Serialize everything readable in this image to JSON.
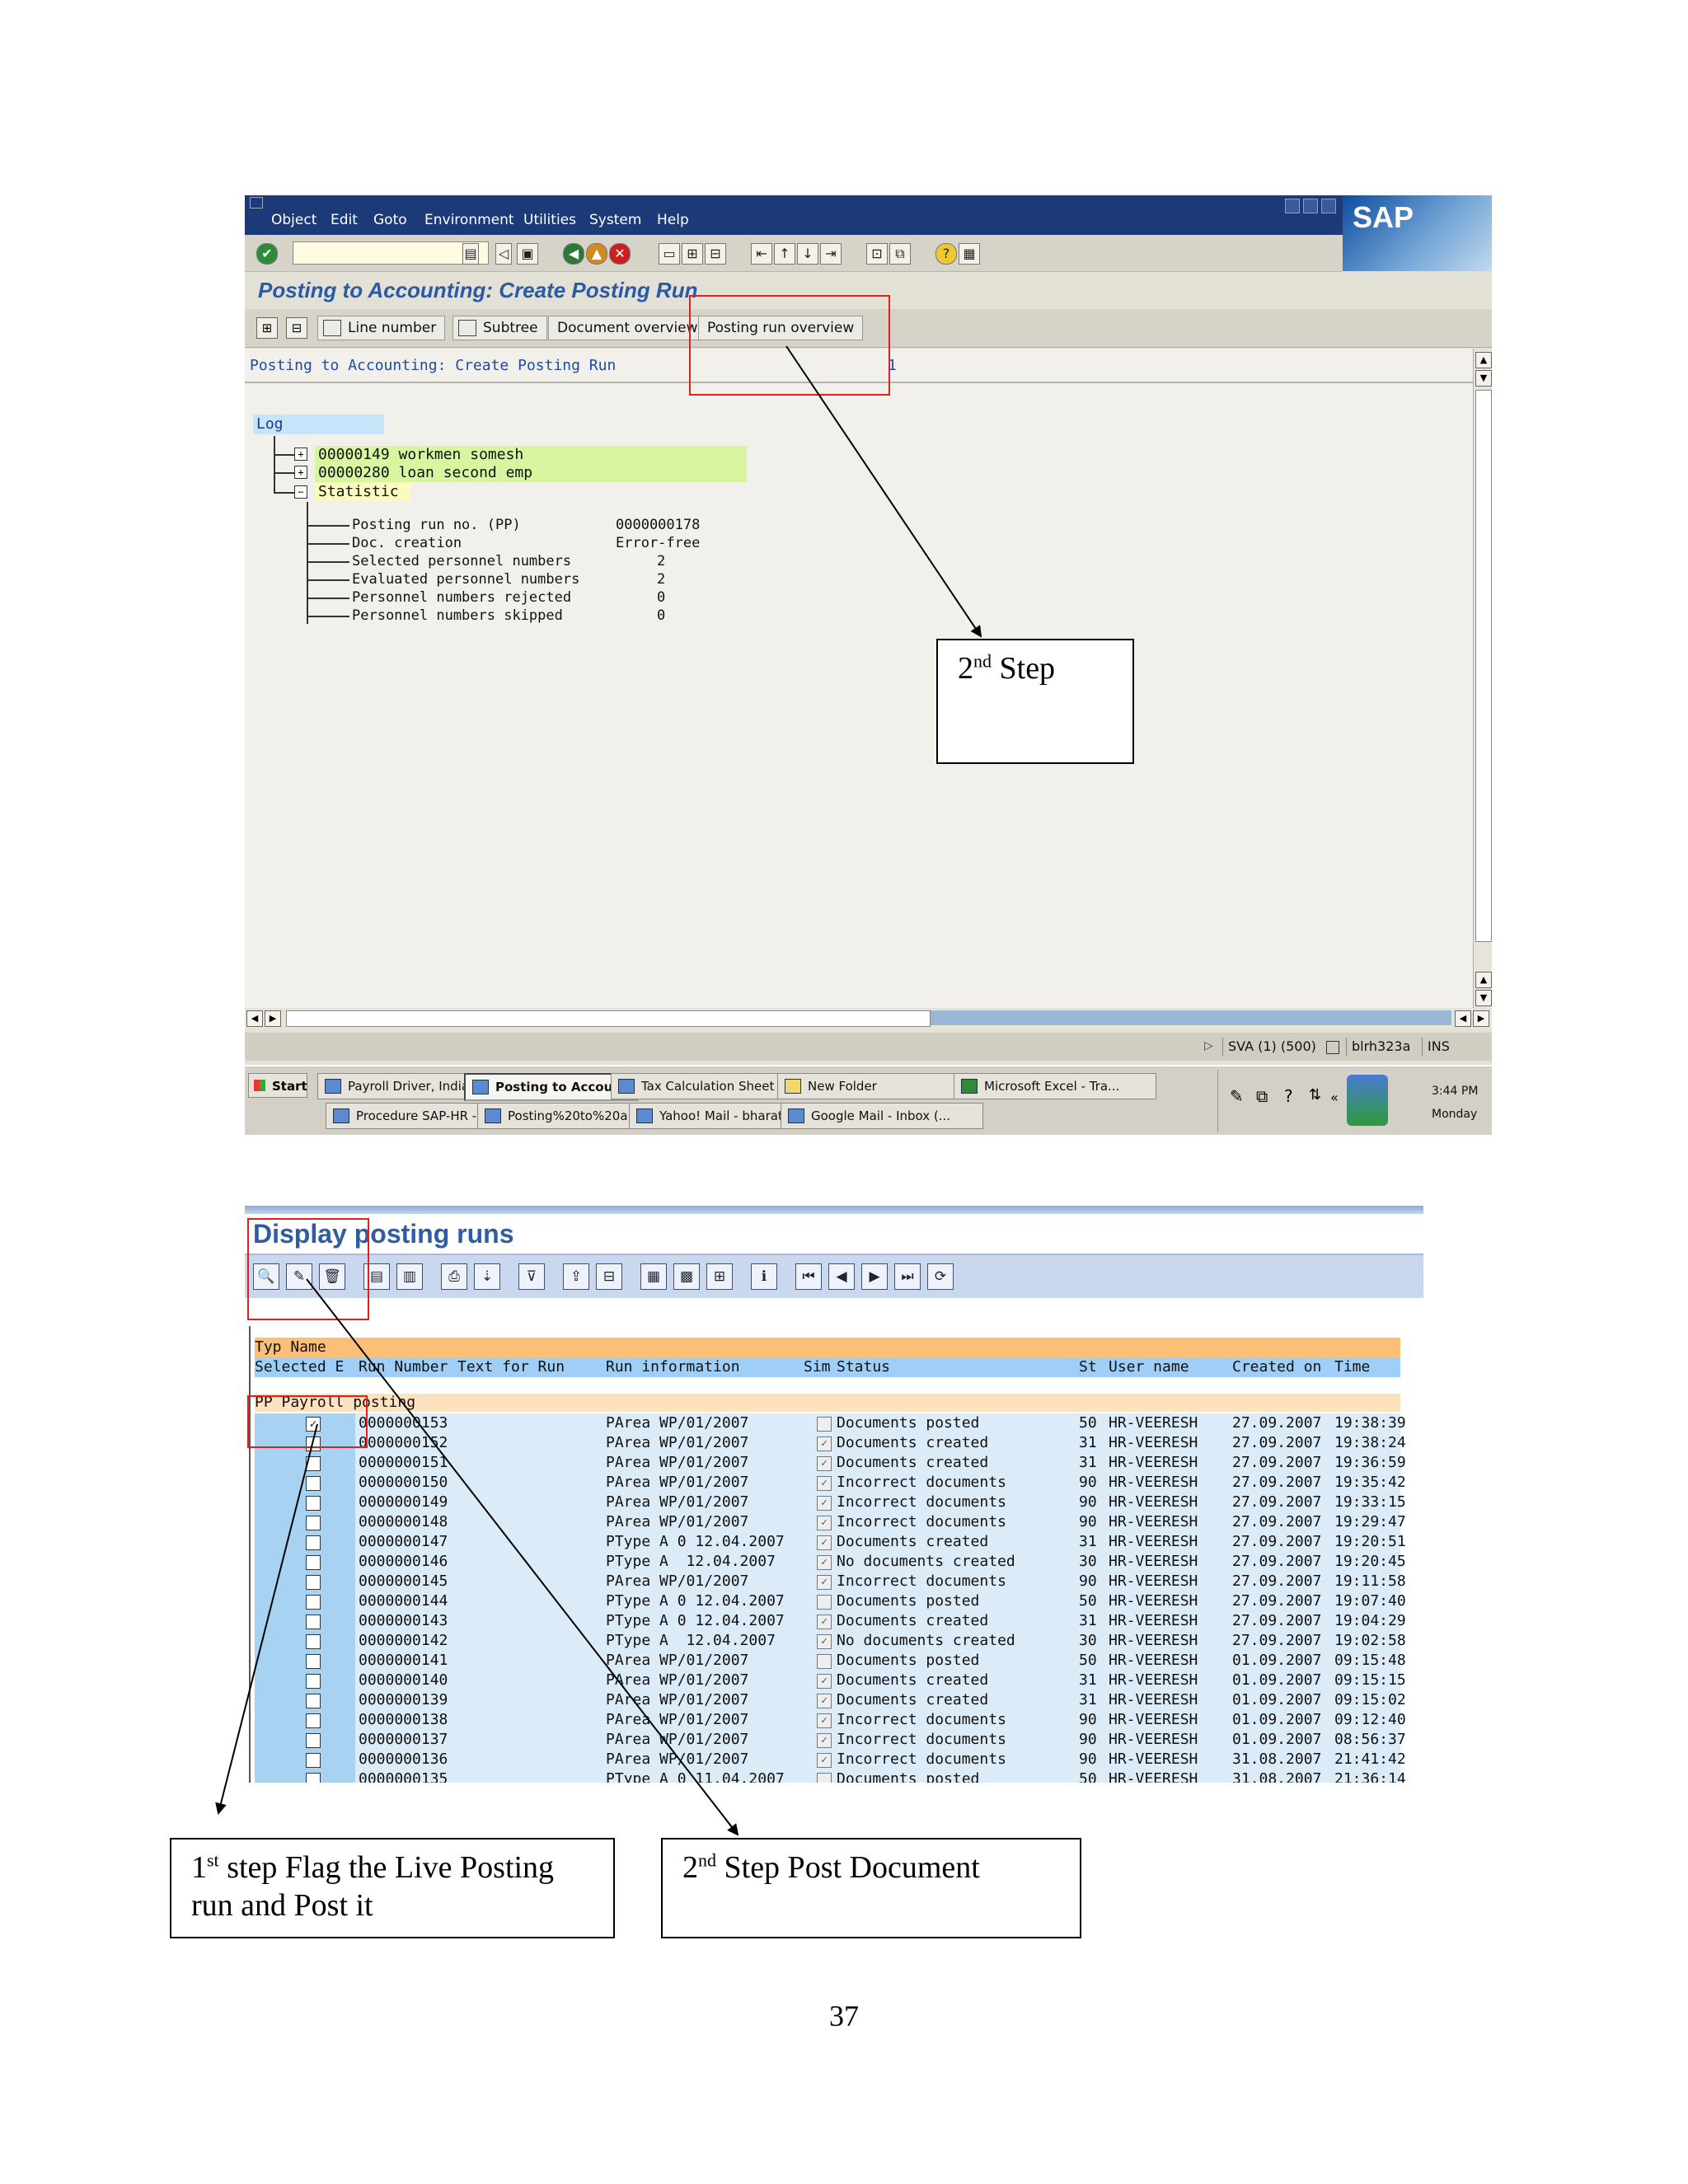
{
  "screenshot1": {
    "menu": [
      "Object",
      "Edit",
      "Goto",
      "Environment",
      "Utilities",
      "System",
      "Help"
    ],
    "logo": "SAP",
    "title": "Posting to Accounting: Create Posting Run",
    "app_toolbar": {
      "line_number": "Line number",
      "subtree": "Subtree",
      "document_overview": "Document overview",
      "posting_run_overview": "Posting run overview"
    },
    "content_header": "Posting to Accounting: Create Posting Run",
    "content_header_num": "1",
    "log_label": "Log",
    "tree": [
      {
        "label": "00000149 workmen somesh"
      },
      {
        "label": "00000280 loan second emp"
      },
      {
        "label": "Statistic"
      }
    ],
    "stats": [
      {
        "label": "Posting run no. (PP)",
        "value": "0000000178"
      },
      {
        "label": "Doc. creation",
        "value": "Error-free"
      },
      {
        "label": "Selected personnel numbers",
        "value": "2"
      },
      {
        "label": "Evaluated personnel numbers",
        "value": "2"
      },
      {
        "label": "Personnel numbers rejected",
        "value": "0"
      },
      {
        "label": "Personnel numbers skipped",
        "value": "0"
      }
    ],
    "status": {
      "system": "SVA (1) (500)",
      "server": "blrh323a",
      "mode": "INS"
    },
    "taskbar": {
      "start": "Start",
      "tasks_top": [
        "Payroll Driver, India ...",
        "Posting to Accoun...",
        "Tax Calculation Sheet",
        "New Folder",
        "Microsoft Excel - Tra..."
      ],
      "tasks_bottom": [
        "Procedure SAP-HR - ...",
        "Posting%20to%20a...",
        "Yahoo! Mail - bharat...",
        "Google Mail - Inbox (..."
      ],
      "clock": "3:44 PM",
      "day": "Monday"
    },
    "callout": {
      "num": "2",
      "sup": "nd",
      "text": " Step"
    }
  },
  "screenshot2": {
    "title": "Display posting runs",
    "header1": "Typ Name",
    "header2": {
      "selected": "Selected E",
      "run": "Run Number",
      "text": "Text for Run",
      "info": "Run information",
      "sim": "Sim",
      "status": "Status",
      "st": "St",
      "user": "User name",
      "created": "Created on",
      "time": "Time"
    },
    "group": "PP  Payroll posting",
    "rows": [
      {
        "sel": true,
        "run": "0000000153",
        "info": "PArea WP/01/2007",
        "sim": false,
        "status": "Documents posted",
        "st": "50",
        "user": "HR-VEERESH",
        "date": "27.09.2007",
        "time": "19:38:39"
      },
      {
        "sel": false,
        "run": "0000000152",
        "info": "PArea WP/01/2007",
        "sim": true,
        "status": "Documents created",
        "st": "31",
        "user": "HR-VEERESH",
        "date": "27.09.2007",
        "time": "19:38:24"
      },
      {
        "sel": false,
        "run": "0000000151",
        "info": "PArea WP/01/2007",
        "sim": true,
        "status": "Documents created",
        "st": "31",
        "user": "HR-VEERESH",
        "date": "27.09.2007",
        "time": "19:36:59"
      },
      {
        "sel": false,
        "run": "0000000150",
        "info": "PArea WP/01/2007",
        "sim": true,
        "status": "Incorrect documents",
        "st": "90",
        "user": "HR-VEERESH",
        "date": "27.09.2007",
        "time": "19:35:42"
      },
      {
        "sel": false,
        "run": "0000000149",
        "info": "PArea WP/01/2007",
        "sim": true,
        "status": "Incorrect documents",
        "st": "90",
        "user": "HR-VEERESH",
        "date": "27.09.2007",
        "time": "19:33:15"
      },
      {
        "sel": false,
        "run": "0000000148",
        "info": "PArea WP/01/2007",
        "sim": true,
        "status": "Incorrect documents",
        "st": "90",
        "user": "HR-VEERESH",
        "date": "27.09.2007",
        "time": "19:29:47"
      },
      {
        "sel": false,
        "run": "0000000147",
        "info": "PType A 0 12.04.2007",
        "sim": true,
        "status": "Documents created",
        "st": "31",
        "user": "HR-VEERESH",
        "date": "27.09.2007",
        "time": "19:20:51"
      },
      {
        "sel": false,
        "run": "0000000146",
        "info": "PType A  12.04.2007",
        "sim": true,
        "status": "No documents created",
        "st": "30",
        "user": "HR-VEERESH",
        "date": "27.09.2007",
        "time": "19:20:45"
      },
      {
        "sel": false,
        "run": "0000000145",
        "info": "PArea WP/01/2007",
        "sim": true,
        "status": "Incorrect documents",
        "st": "90",
        "user": "HR-VEERESH",
        "date": "27.09.2007",
        "time": "19:11:58"
      },
      {
        "sel": false,
        "run": "0000000144",
        "info": "PType A 0 12.04.2007",
        "sim": false,
        "status": "Documents posted",
        "st": "50",
        "user": "HR-VEERESH",
        "date": "27.09.2007",
        "time": "19:07:40"
      },
      {
        "sel": false,
        "run": "0000000143",
        "info": "PType A 0 12.04.2007",
        "sim": true,
        "status": "Documents created",
        "st": "31",
        "user": "HR-VEERESH",
        "date": "27.09.2007",
        "time": "19:04:29"
      },
      {
        "sel": false,
        "run": "0000000142",
        "info": "PType A  12.04.2007",
        "sim": true,
        "status": "No documents created",
        "st": "30",
        "user": "HR-VEERESH",
        "date": "27.09.2007",
        "time": "19:02:58"
      },
      {
        "sel": false,
        "run": "0000000141",
        "info": "PArea WP/01/2007",
        "sim": false,
        "status": "Documents posted",
        "st": "50",
        "user": "HR-VEERESH",
        "date": "01.09.2007",
        "time": "09:15:48"
      },
      {
        "sel": false,
        "run": "0000000140",
        "info": "PArea WP/01/2007",
        "sim": true,
        "status": "Documents created",
        "st": "31",
        "user": "HR-VEERESH",
        "date": "01.09.2007",
        "time": "09:15:15"
      },
      {
        "sel": false,
        "run": "0000000139",
        "info": "PArea WP/01/2007",
        "sim": true,
        "status": "Documents created",
        "st": "31",
        "user": "HR-VEERESH",
        "date": "01.09.2007",
        "time": "09:15:02"
      },
      {
        "sel": false,
        "run": "0000000138",
        "info": "PArea WP/01/2007",
        "sim": true,
        "status": "Incorrect documents",
        "st": "90",
        "user": "HR-VEERESH",
        "date": "01.09.2007",
        "time": "09:12:40"
      },
      {
        "sel": false,
        "run": "0000000137",
        "info": "PArea WP/01/2007",
        "sim": true,
        "status": "Incorrect documents",
        "st": "90",
        "user": "HR-VEERESH",
        "date": "01.09.2007",
        "time": "08:56:37"
      },
      {
        "sel": false,
        "run": "0000000136",
        "info": "PArea WP/01/2007",
        "sim": true,
        "status": "Incorrect documents",
        "st": "90",
        "user": "HR-VEERESH",
        "date": "31.08.2007",
        "time": "21:41:42"
      },
      {
        "sel": false,
        "run": "0000000135",
        "info": "PType A 0 11.04.2007",
        "sim": false,
        "status": "Documents posted",
        "st": "50",
        "user": "HR-VEERESH",
        "date": "31.08.2007",
        "time": "21:36:14"
      }
    ]
  },
  "callouts": {
    "first": {
      "num": "1",
      "sup": "st",
      "text": " step Flag the Live Posting run and Post it"
    },
    "second": {
      "num": "2",
      "sup": "nd",
      "text": " Step Post Document"
    }
  },
  "page_number": "37"
}
